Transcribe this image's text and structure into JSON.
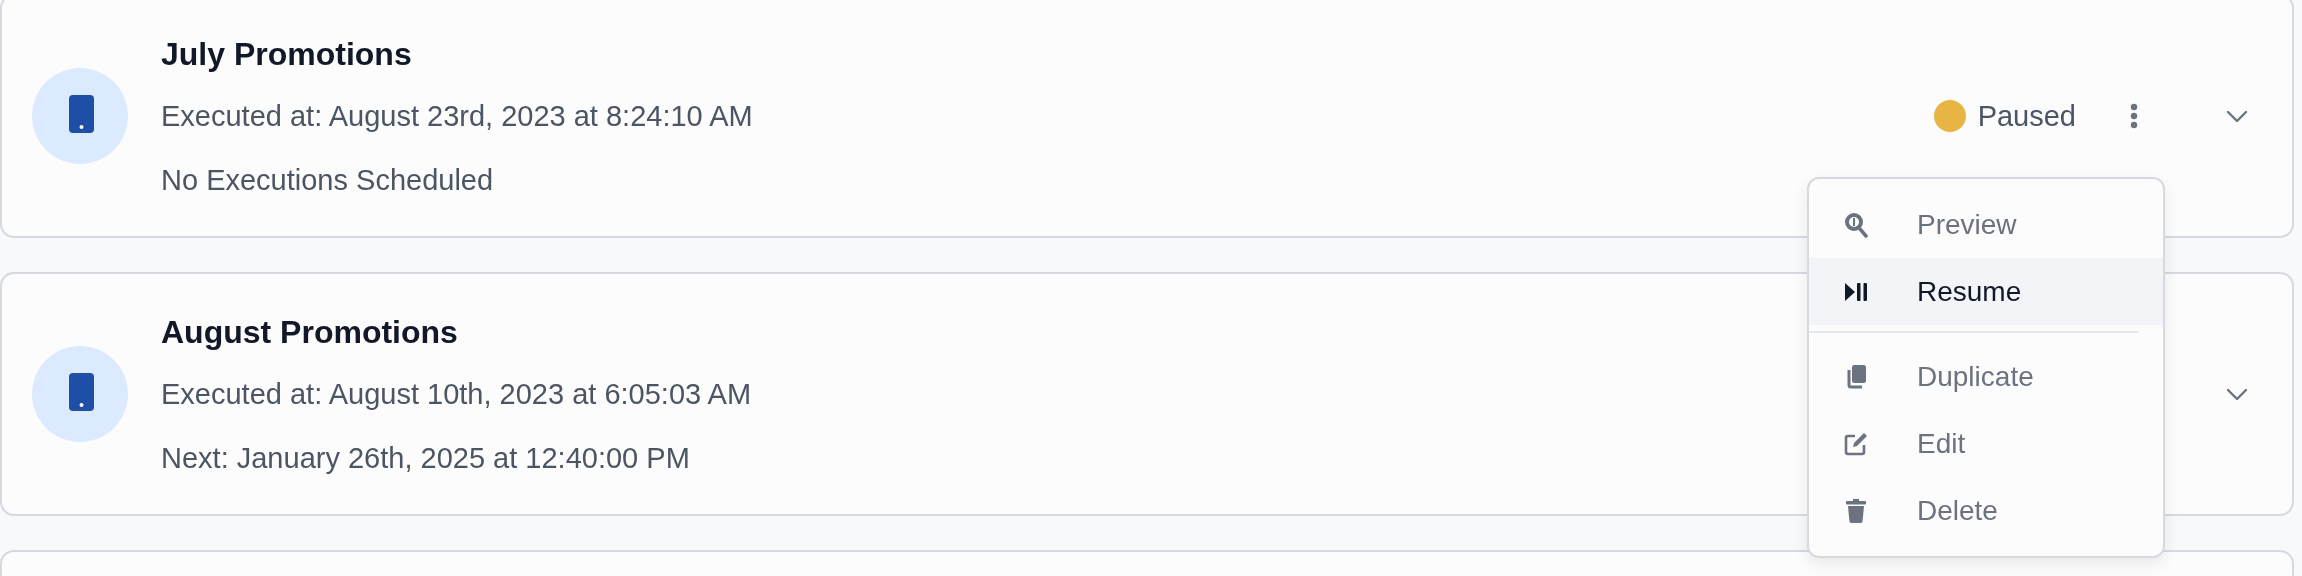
{
  "campaigns": [
    {
      "title": "July Promotions",
      "executed": "Executed at: August 23rd, 2023 at 8:24:10 AM",
      "next": "No Executions Scheduled",
      "status": {
        "label": "Paused",
        "color": "#e8b544"
      },
      "actions_menu": true,
      "expanded": false
    },
    {
      "title": "August Promotions",
      "executed": "Executed at: August 10th, 2023 at 6:05:03 AM",
      "next": "Next: January 26th, 2025 at 12:40:00 PM",
      "expanded": false
    }
  ],
  "menu": {
    "groups": [
      [
        {
          "kind": "preview",
          "label": "Preview",
          "selected": false
        },
        {
          "kind": "resume",
          "label": "Resume",
          "selected": true
        }
      ],
      [
        {
          "kind": "duplicate",
          "label": "Duplicate",
          "selected": false
        },
        {
          "kind": "edit",
          "label": "Edit",
          "selected": false
        },
        {
          "kind": "delete",
          "label": "Delete",
          "selected": false
        }
      ]
    ]
  }
}
